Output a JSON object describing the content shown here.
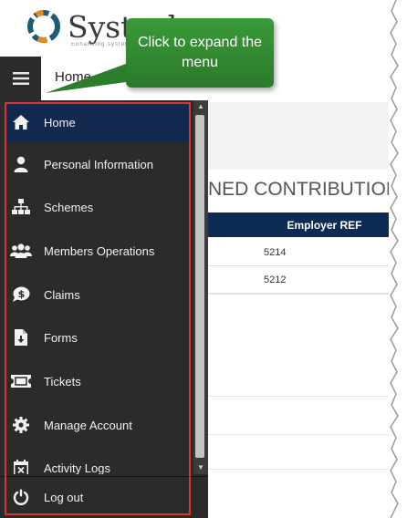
{
  "app": {
    "logo_text": "Systech",
    "logo_tagline": "Enhancing systems"
  },
  "header": {
    "menu_toggle_icon": "hamburger-icon",
    "breadcrumb": "Home"
  },
  "callout": {
    "text": "Click to expand the menu"
  },
  "sidebar": {
    "items": [
      {
        "label": "Home",
        "icon": "home-icon",
        "active": true
      },
      {
        "label": "Personal Information",
        "icon": "person-icon"
      },
      {
        "label": "Schemes",
        "icon": "sitemap-icon"
      },
      {
        "label": "Members Operations",
        "icon": "users-icon"
      },
      {
        "label": "Claims",
        "icon": "money-bubble-icon"
      },
      {
        "label": "Forms",
        "icon": "file-download-icon"
      },
      {
        "label": "Tickets",
        "icon": "ticket-icon"
      },
      {
        "label": "Manage Account",
        "icon": "gear-icon"
      },
      {
        "label": "Activity Logs",
        "icon": "calendar-x-icon"
      }
    ],
    "logout_label": "Log out",
    "logout_icon": "power-icon"
  },
  "main": {
    "section_title": "NED CONTRIBUTION",
    "table": {
      "header": "Employer REF",
      "rows": [
        "5214",
        "5212"
      ]
    }
  },
  "colors": {
    "sidebar_bg": "#2b2b2b",
    "active_item_bg": "#11294f",
    "table_header_bg": "#0d2b53",
    "callout_green": "#2f8a2f",
    "highlight_red": "#d33333"
  }
}
